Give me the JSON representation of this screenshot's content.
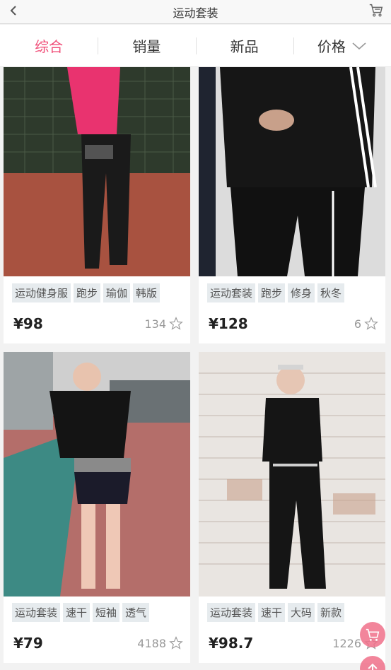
{
  "header": {
    "title": "运动套装",
    "back_icon": "chevron-left-icon",
    "cart_icon": "shopping-cart-icon"
  },
  "tabs": [
    {
      "label": "综合",
      "active": true
    },
    {
      "label": "销量",
      "active": false
    },
    {
      "label": "新品",
      "active": false
    },
    {
      "label": "价格",
      "active": false
    }
  ],
  "colors": {
    "accent": "#f0507a",
    "tag_bg": "#e6ebee"
  },
  "products": [
    {
      "tags": [
        "运动健身服",
        "跑步",
        "瑜伽",
        "韩版"
      ],
      "price": "¥98",
      "sales": "134"
    },
    {
      "tags": [
        "运动套装",
        "跑步",
        "修身",
        "秋冬"
      ],
      "price": "¥128",
      "sales": "6"
    },
    {
      "tags": [
        "运动套装",
        "速干",
        "短袖",
        "透气"
      ],
      "price": "¥79",
      "sales": "4188"
    },
    {
      "tags": [
        "运动套装",
        "速干",
        "大码",
        "新款"
      ],
      "price": "¥98.7",
      "sales": "1226"
    }
  ]
}
